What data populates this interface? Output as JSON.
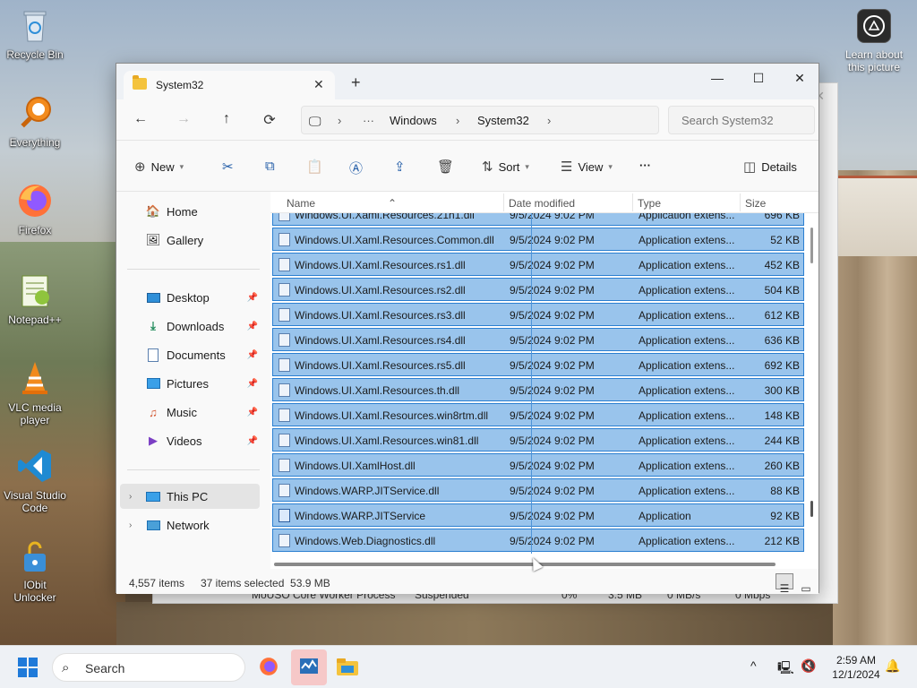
{
  "desktop": {
    "icons": [
      {
        "label": "Recycle Bin"
      },
      {
        "label": "Everything"
      },
      {
        "label": "Firefox"
      },
      {
        "label": "Notepad++"
      },
      {
        "label": "VLC media player"
      },
      {
        "label": "Visual Studio Code"
      },
      {
        "label": "IObit Unlocker"
      }
    ],
    "learn_label": "Learn about this picture"
  },
  "background_window": {
    "process_name": "MoUSO Core Worker Process",
    "status": "Suspended",
    "cpu": "0%",
    "memory": "3.5 MB",
    "disk": "0 MB/s",
    "network": "0 Mbps"
  },
  "explorer": {
    "tab_title": "System32",
    "window_controls": {
      "minimize": "—",
      "maximize": "☐",
      "close": "✕"
    },
    "breadcrumb": [
      "Windows",
      "System32"
    ],
    "search_placeholder": "Search System32",
    "toolbar": {
      "new": "New",
      "sort": "Sort",
      "view": "View",
      "more": "···",
      "details": "Details"
    },
    "sidebar": {
      "quick": [
        {
          "label": "Home"
        },
        {
          "label": "Gallery"
        }
      ],
      "pinned": [
        {
          "label": "Desktop"
        },
        {
          "label": "Downloads"
        },
        {
          "label": "Documents"
        },
        {
          "label": "Pictures"
        },
        {
          "label": "Music"
        },
        {
          "label": "Videos"
        }
      ],
      "locations": [
        {
          "label": "This PC"
        },
        {
          "label": "Network"
        }
      ]
    },
    "columns": {
      "name": "Name",
      "date": "Date modified",
      "type": "Type",
      "size": "Size"
    },
    "files": [
      {
        "name": "Windows.UI.Xaml.Resources.21h1.dll",
        "date": "9/5/2024 9:02 PM",
        "type": "Application extens...",
        "size": "696 KB"
      },
      {
        "name": "Windows.UI.Xaml.Resources.Common.dll",
        "date": "9/5/2024 9:02 PM",
        "type": "Application extens...",
        "size": "52 KB"
      },
      {
        "name": "Windows.UI.Xaml.Resources.rs1.dll",
        "date": "9/5/2024 9:02 PM",
        "type": "Application extens...",
        "size": "452 KB"
      },
      {
        "name": "Windows.UI.Xaml.Resources.rs2.dll",
        "date": "9/5/2024 9:02 PM",
        "type": "Application extens...",
        "size": "504 KB"
      },
      {
        "name": "Windows.UI.Xaml.Resources.rs3.dll",
        "date": "9/5/2024 9:02 PM",
        "type": "Application extens...",
        "size": "612 KB"
      },
      {
        "name": "Windows.UI.Xaml.Resources.rs4.dll",
        "date": "9/5/2024 9:02 PM",
        "type": "Application extens...",
        "size": "636 KB"
      },
      {
        "name": "Windows.UI.Xaml.Resources.rs5.dll",
        "date": "9/5/2024 9:02 PM",
        "type": "Application extens...",
        "size": "692 KB"
      },
      {
        "name": "Windows.UI.Xaml.Resources.th.dll",
        "date": "9/5/2024 9:02 PM",
        "type": "Application extens...",
        "size": "300 KB"
      },
      {
        "name": "Windows.UI.Xaml.Resources.win8rtm.dll",
        "date": "9/5/2024 9:02 PM",
        "type": "Application extens...",
        "size": "148 KB"
      },
      {
        "name": "Windows.UI.Xaml.Resources.win81.dll",
        "date": "9/5/2024 9:02 PM",
        "type": "Application extens...",
        "size": "244 KB"
      },
      {
        "name": "Windows.UI.XamlHost.dll",
        "date": "9/5/2024 9:02 PM",
        "type": "Application extens...",
        "size": "260 KB"
      },
      {
        "name": "Windows.WARP.JITService.dll",
        "date": "9/5/2024 9:02 PM",
        "type": "Application extens...",
        "size": "88 KB"
      },
      {
        "name": "Windows.WARP.JITService",
        "date": "9/5/2024 9:02 PM",
        "type": "Application",
        "size": "92 KB"
      },
      {
        "name": "Windows.Web.Diagnostics.dll",
        "date": "9/5/2024 9:02 PM",
        "type": "Application extens...",
        "size": "212 KB"
      }
    ],
    "status": {
      "items": "4,557 items",
      "selected": "37 items selected  53.9 MB"
    }
  },
  "taskbar": {
    "search_label": "Search",
    "time": "2:59 AM",
    "date": "12/1/2024"
  },
  "colors": {
    "selection": "#99c4ec",
    "selection_border": "#2b7fd0",
    "accent": "#1f7ad9"
  }
}
